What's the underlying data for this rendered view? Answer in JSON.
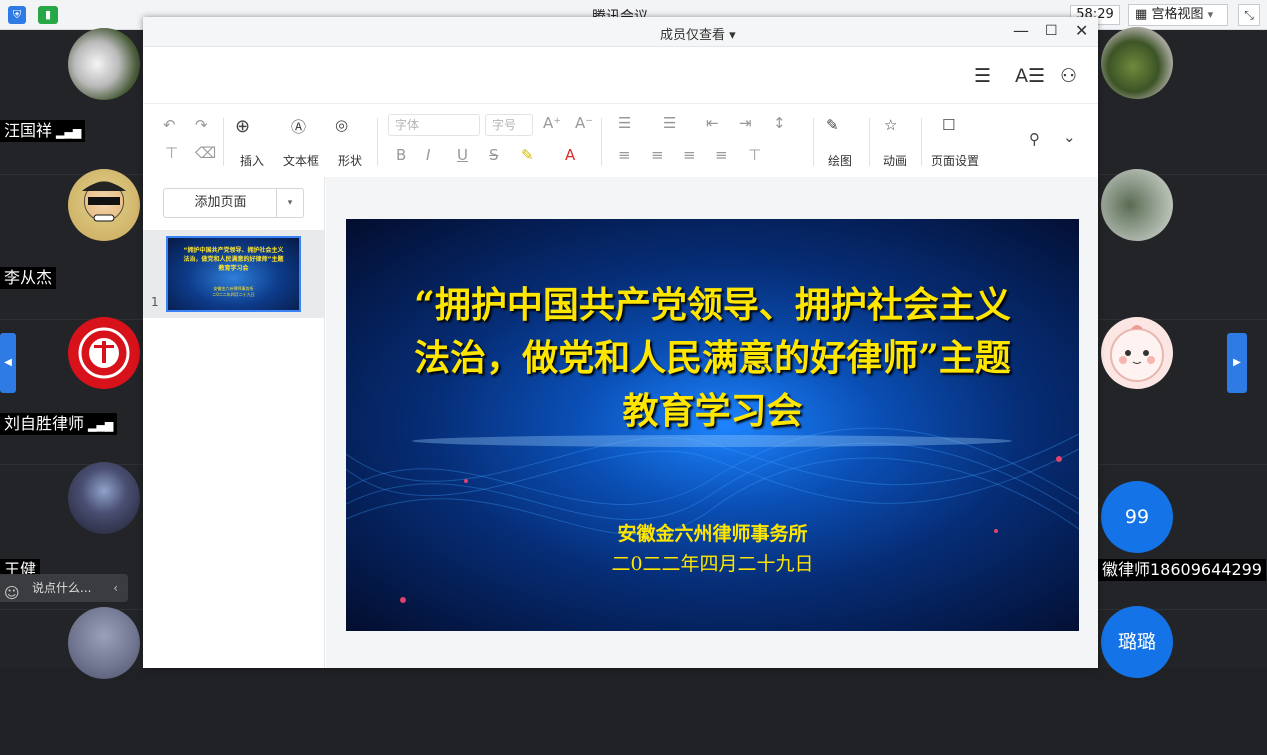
{
  "app": {
    "title": "腾讯会议",
    "timer": "58:29",
    "view_mode": "宫格视图",
    "view_mode_caret": "▾"
  },
  "participants_left": [
    {
      "name": "汪国祥",
      "signal": true
    },
    {
      "name": "李从杰",
      "signal": false
    },
    {
      "name": "刘自胜律师",
      "signal": true
    },
    {
      "name": "王健",
      "signal": false
    }
  ],
  "participants_right": [
    {
      "name": "",
      "badge": ""
    },
    {
      "name": "",
      "badge": ""
    },
    {
      "name": "",
      "badge": ""
    },
    {
      "name": "徽律师18609644299",
      "badge": "99"
    },
    {
      "name": "",
      "badge": "璐璐"
    }
  ],
  "chat": {
    "placeholder": "说点什么..."
  },
  "doc_window": {
    "caption": "成员仅查看 ▾",
    "controls": {
      "minimize": "—",
      "maximize": "☐",
      "close": "✕"
    }
  },
  "toolbar": {
    "font_placeholder": "字体",
    "size_placeholder": "字号",
    "insert": "插入",
    "textbox": "文本框",
    "shape": "形状",
    "draw": "绘图",
    "animation": "动画",
    "page_setup": "页面设置"
  },
  "side_panel": {
    "add_page": "添加页面",
    "slide_number": "1"
  },
  "slide": {
    "title_lines": [
      "“拥护中国共产党领导、拥护社会主义",
      "法治，做党和人民满意的好律师”主题",
      "教育学习会"
    ],
    "org": "安徽金六州律师事务所",
    "date": "二0二二年四月二十九日"
  },
  "colors": {
    "accent": "#2f7be5",
    "slide_text": "#ffe600",
    "badge": "#1473e6"
  }
}
